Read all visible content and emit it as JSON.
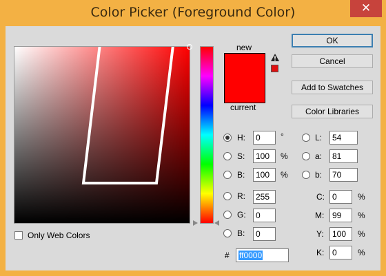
{
  "window": {
    "title": "Color Picker (Foreground Color)",
    "close_glyph": "✕"
  },
  "field": {
    "saturation": 1.0,
    "brightness": 1.0
  },
  "hue_slider": {
    "hue": 0
  },
  "only_web_colors": {
    "label": "Only Web Colors",
    "checked": false
  },
  "swatches": {
    "new_label": "new",
    "current_label": "current",
    "new_color": "#ff0000",
    "current_color": "#ff0000",
    "gamut_warning_icon": "warning-triangle-icon"
  },
  "buttons": {
    "ok": "OK",
    "cancel": "Cancel",
    "add_to_swatches": "Add to Swatches",
    "color_libraries": "Color Libraries"
  },
  "hsb": {
    "h": {
      "label": "H:",
      "value": "0",
      "unit": "°",
      "selected": true
    },
    "s": {
      "label": "S:",
      "value": "100",
      "unit": "%",
      "selected": false
    },
    "b": {
      "label": "B:",
      "value": "100",
      "unit": "%",
      "selected": false
    }
  },
  "rgb": {
    "r": {
      "label": "R:",
      "value": "255"
    },
    "g": {
      "label": "G:",
      "value": "0"
    },
    "b": {
      "label": "B:",
      "value": "0"
    }
  },
  "lab": {
    "l": {
      "label": "L:",
      "value": "54"
    },
    "a": {
      "label": "a:",
      "value": "81"
    },
    "b": {
      "label": "b:",
      "value": "70"
    }
  },
  "cmyk": {
    "c": {
      "label": "C:",
      "value": "0",
      "unit": "%"
    },
    "m": {
      "label": "M:",
      "value": "99",
      "unit": "%"
    },
    "y": {
      "label": "Y:",
      "value": "100",
      "unit": "%"
    },
    "k": {
      "label": "K:",
      "value": "0",
      "unit": "%"
    }
  },
  "hex": {
    "label": "#",
    "value": "ff0000"
  }
}
